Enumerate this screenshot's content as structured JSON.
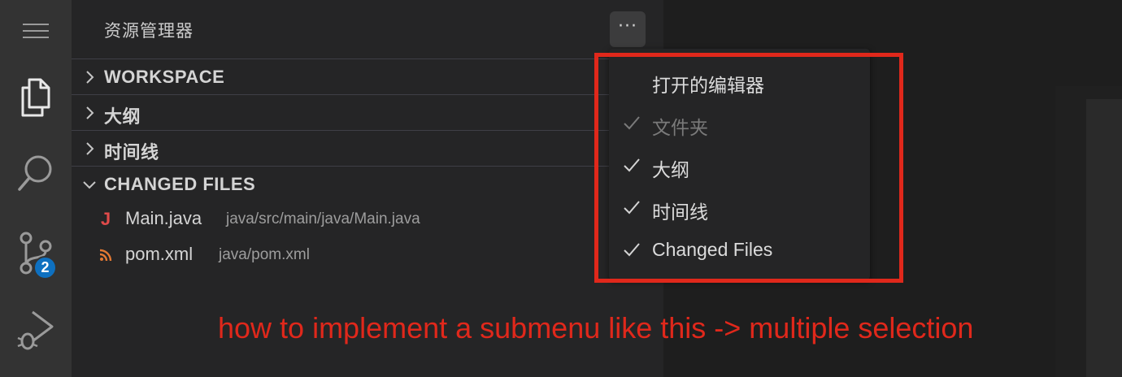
{
  "sidebar": {
    "title": "资源管理器",
    "more_label": "···",
    "sections": [
      {
        "label": "WORKSPACE",
        "expanded": false
      },
      {
        "label": "大纲",
        "expanded": false
      },
      {
        "label": "时间线",
        "expanded": false
      },
      {
        "label": "CHANGED FILES",
        "expanded": true
      }
    ],
    "files": [
      {
        "icon": "java-icon",
        "icon_text": "J",
        "name": "Main.java",
        "path": "java/src/main/java/Main.java"
      },
      {
        "icon": "rss-icon",
        "name": "pom.xml",
        "path": "java/pom.xml"
      }
    ]
  },
  "activity_bar": {
    "items": [
      "menu-icon",
      "files-icon",
      "search-icon",
      "source-control-icon",
      "run-debug-icon"
    ],
    "source_control_badge": "2"
  },
  "menu": {
    "items": [
      {
        "label": "打开的编辑器",
        "checked": false,
        "disabled": false
      },
      {
        "label": "文件夹",
        "checked": true,
        "disabled": true
      },
      {
        "label": "大纲",
        "checked": true,
        "disabled": false
      },
      {
        "label": "时间线",
        "checked": true,
        "disabled": false
      },
      {
        "label": "Changed Files",
        "checked": true,
        "disabled": false
      }
    ]
  },
  "annotation": {
    "text": "how to implement a submenu like this -> multiple selection",
    "color": "#e0281b"
  },
  "colors": {
    "activity_bar": "#333333",
    "sidebar": "#252526",
    "editor": "#1e1e1e",
    "badge": "#0e70c0",
    "java": "#e04a4a",
    "rss": "#e37933"
  }
}
